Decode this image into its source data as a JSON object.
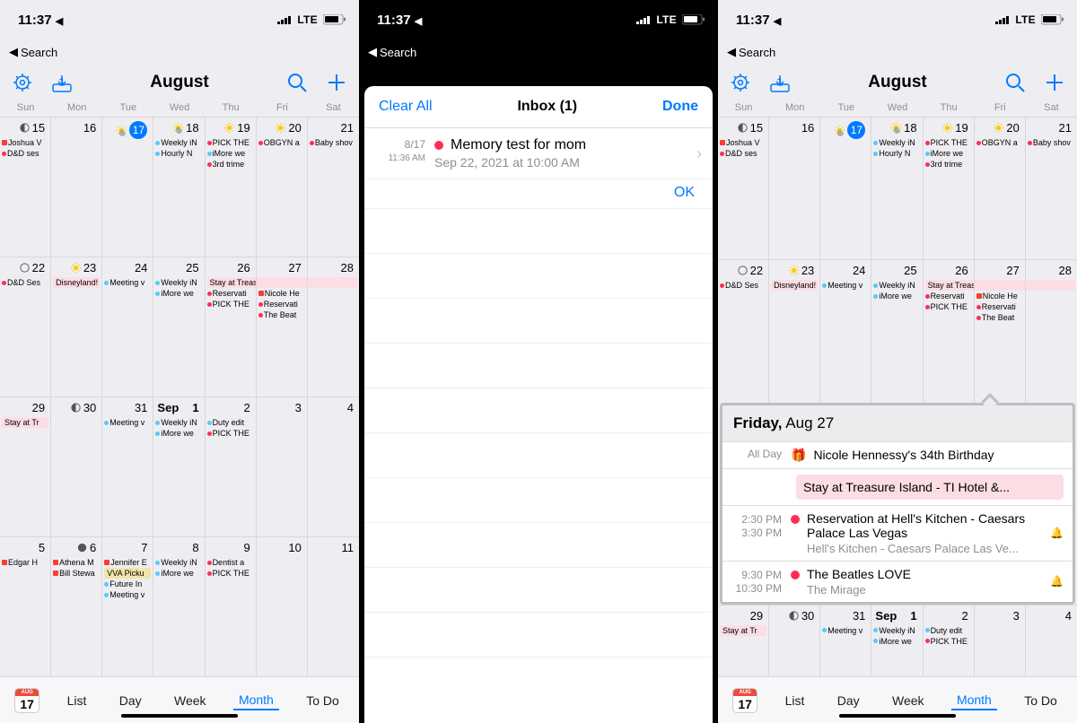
{
  "status": {
    "time": "11:37",
    "carrier": "LTE"
  },
  "back_label": "Search",
  "month_title": "August",
  "inbox_badge": "1",
  "weekdays": [
    "Sun",
    "Mon",
    "Tue",
    "Wed",
    "Thu",
    "Fri",
    "Sat"
  ],
  "tabs": {
    "list": "List",
    "day": "Day",
    "week": "Week",
    "month": "Month",
    "todo": "To Do",
    "icon_month": "AUG",
    "icon_day": "17"
  },
  "week1": {
    "d0": "15",
    "d1": "16",
    "d2": "17",
    "d3": "18",
    "d4": "19",
    "d5": "20",
    "d6": "21",
    "joshua": "Joshua V",
    "dd": "D&D ses",
    "weekly": "Weekly iN",
    "pick": "PICK THE",
    "obgyn": "OBGYN a",
    "baby": "Baby shov",
    "hourly": "Hourly N",
    "imore": "iMore we",
    "trim": "3rd trime"
  },
  "week2": {
    "d0": "22",
    "d1": "23",
    "d2": "24",
    "d3": "25",
    "d4": "26",
    "d5": "27",
    "d6": "28",
    "dd": "D&D Ses",
    "disney": "Disneyland!",
    "stay": "Stay at Treasure Island - TI Hotel",
    "meeting": "Meeting v",
    "weekly": "Weekly iN",
    "reserv": "Reservati",
    "nicole": "Nicole He",
    "imore": "iMore we",
    "pick": "PICK THE",
    "reserv2": "Reservati",
    "beat": "The Beat"
  },
  "week3": {
    "d0": "29",
    "d1": "30",
    "d2": "31",
    "d3m": "Sep",
    "d3": "1",
    "d4": "2",
    "d5": "3",
    "d6": "4",
    "stay": "Stay at Tr",
    "meeting": "Meeting v",
    "weekly": "Weekly iN",
    "duty": "Duty edit",
    "imore": "iMore we",
    "pick": "PICK THE"
  },
  "week4": {
    "d0": "5",
    "d1": "6",
    "d2": "7",
    "d3": "8",
    "d4": "9",
    "d5": "10",
    "d6": "11",
    "edgar": "Edgar H",
    "athena": "Athena M",
    "jennifer": "Jennifer E",
    "weekly": "Weekly iN",
    "dentist": "Dentist a",
    "bill": "Bill Stewa",
    "vva": "VVA Picku",
    "imore": "iMore we",
    "pick": "PICK THE",
    "future": "Future In",
    "meeting": "Meeting v"
  },
  "inbox": {
    "clear": "Clear All",
    "title": "Inbox (1)",
    "done": "Done",
    "date": "8/17",
    "time": "11:36 AM",
    "subject": "Memory test for mom",
    "when": "Sep 22, 2021 at 10:00 AM",
    "ok": "OK"
  },
  "popover": {
    "day_label": "Friday,",
    "day_date": "Aug 27",
    "allday": "All Day",
    "bday": "Nicole Hennessy's 34th Birthday",
    "stay": "Stay at Treasure Island - TI Hotel &...",
    "t1a": "2:30 PM",
    "t1b": "3:30 PM",
    "hells": "Reservation at Hell's Kitchen - Caesars Palace Las Vegas",
    "hells_sub": "Hell's Kitchen - Caesars Palace Las Ve...",
    "t2a": "9:30 PM",
    "t2b": "10:30 PM",
    "beatles": "The Beatles LOVE",
    "beatles_sub": "The Mirage"
  }
}
